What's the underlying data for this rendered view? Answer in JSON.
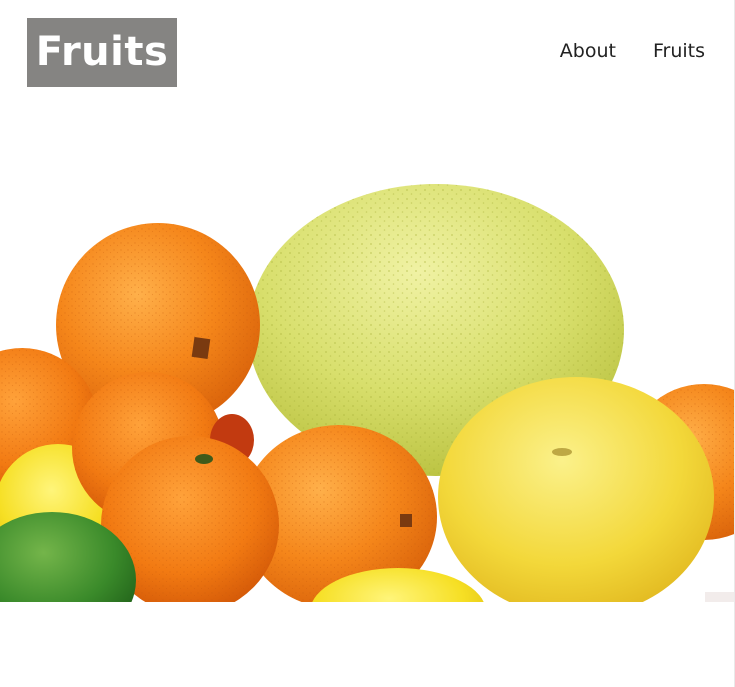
{
  "header": {
    "logo_text": "Fruits",
    "nav": [
      {
        "label": "About"
      },
      {
        "label": "Fruits"
      }
    ]
  },
  "hero": {
    "image_subject": "citrus-fruits-photo",
    "colors": {
      "orange": "#f08a1c",
      "pomelo": "#d9df6a",
      "grapefruit": "#f4dc3c",
      "lime": "#3c8a2a",
      "lemon": "#f6df24"
    }
  }
}
